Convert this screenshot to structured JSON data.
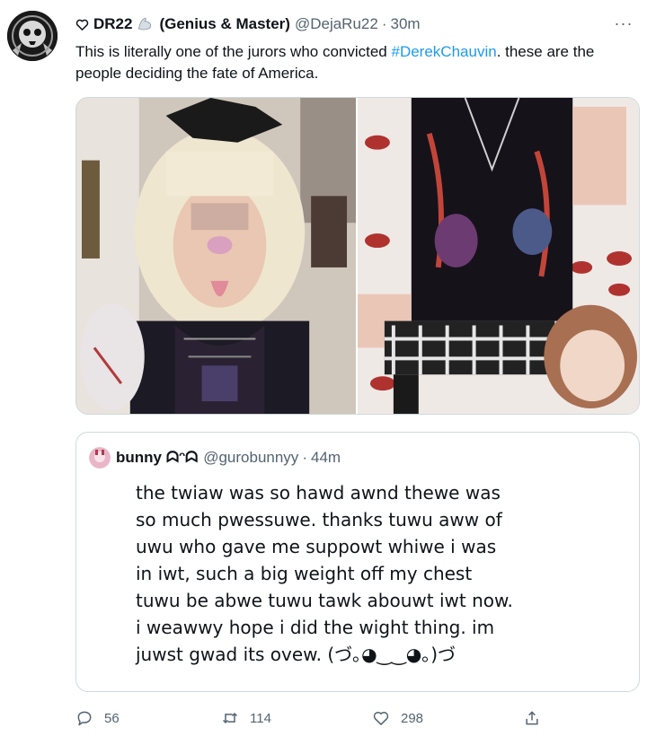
{
  "tweet": {
    "display_name": "DR22",
    "name_suffix": "(Genius & Master)",
    "handle": "@DejaRu22",
    "separator": "·",
    "time": "30m",
    "more_label": "···",
    "text_before": "This is literally one of the jurors who convicted ",
    "hashtag": "#DerekChauvin",
    "text_after": ". these are the people deciding the fate of America.",
    "icons": {
      "name_prefix": "heart-outline-icon",
      "name_emoji": "flexed-biceps-icon"
    },
    "colors": {
      "link": "#1d9bf0",
      "secondary_text": "#536471",
      "border": "#cfd9de"
    }
  },
  "quote": {
    "display_name": "bunny",
    "name_glyphs": "ᗣᵔᗣ",
    "handle": "@gurobunnyy",
    "separator": "·",
    "time": "44m",
    "text": "the twiaw was so hawd awnd thewe was\nso much pwessuwe. thanks tuwu aww of\nuwu who gave me suppowt whiwe i was\nin iwt, such a big weight off my chest\ntuwu be abwe tuwu tawk abouwt iwt now.\ni weawwy hope i did the wight thing. im\njuwst gwad its ovew.  (づ｡◕‿‿◕｡)づ"
  },
  "actions": {
    "reply_count": "56",
    "retweet_count": "114",
    "like_count": "298",
    "icons": [
      "reply-icon",
      "retweet-icon",
      "like-icon",
      "share-icon"
    ]
  }
}
